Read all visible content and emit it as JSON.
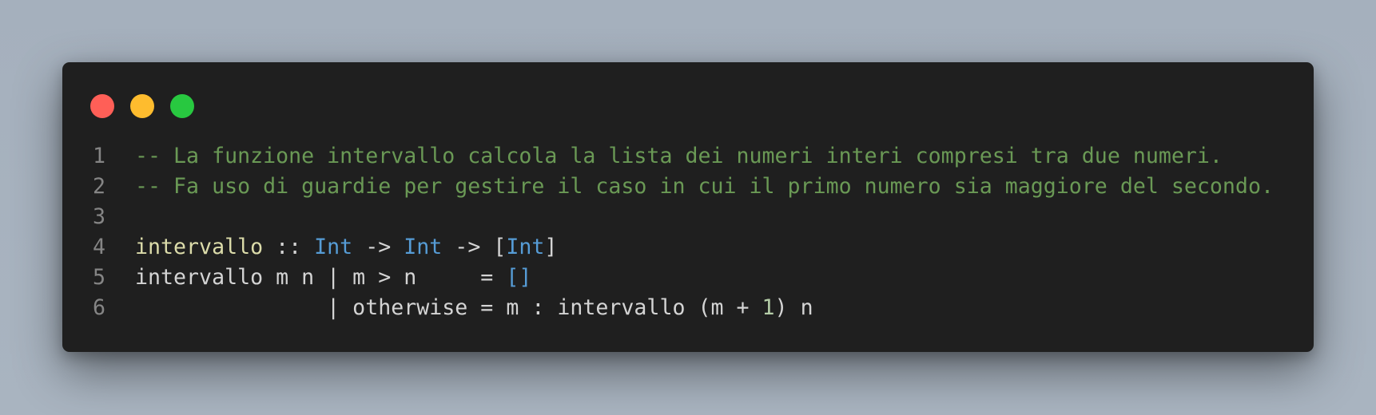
{
  "window": {
    "controls": [
      {
        "name": "close",
        "color": "#ff5f57"
      },
      {
        "name": "minimize",
        "color": "#febc2e"
      },
      {
        "name": "zoom",
        "color": "#28c840"
      }
    ]
  },
  "editor": {
    "language": "haskell",
    "lines": [
      {
        "number": "1",
        "tokens": [
          {
            "text": "-- La funzione intervallo calcola la lista dei numeri interi compresi tra due numeri.",
            "kind": "comment"
          }
        ]
      },
      {
        "number": "2",
        "tokens": [
          {
            "text": "-- Fa uso di guardie per gestire il caso in cui il primo numero sia maggiore del secondo.",
            "kind": "comment"
          }
        ]
      },
      {
        "number": "3",
        "tokens": []
      },
      {
        "number": "4",
        "tokens": [
          {
            "text": "intervallo",
            "kind": "fn"
          },
          {
            "text": " :: ",
            "kind": "plain"
          },
          {
            "text": "Int",
            "kind": "type"
          },
          {
            "text": " -> ",
            "kind": "plain"
          },
          {
            "text": "Int",
            "kind": "type"
          },
          {
            "text": " -> [",
            "kind": "plain"
          },
          {
            "text": "Int",
            "kind": "type"
          },
          {
            "text": "]",
            "kind": "plain"
          }
        ]
      },
      {
        "number": "5",
        "tokens": [
          {
            "text": "intervallo m n | m > n     = ",
            "kind": "plain"
          },
          {
            "text": "[]",
            "kind": "list"
          }
        ]
      },
      {
        "number": "6",
        "tokens": [
          {
            "text": "               | otherwise = m : intervallo (m + ",
            "kind": "plain"
          },
          {
            "text": "1",
            "kind": "num"
          },
          {
            "text": ") n",
            "kind": "plain"
          }
        ]
      }
    ]
  },
  "colors": {
    "background": "#1f1f1f",
    "comment": "#6a9955",
    "function": "#dcdcaa",
    "type": "#569cd6",
    "plain": "#d4d4d4",
    "number": "#b5cea8",
    "line_number": "#858585"
  }
}
